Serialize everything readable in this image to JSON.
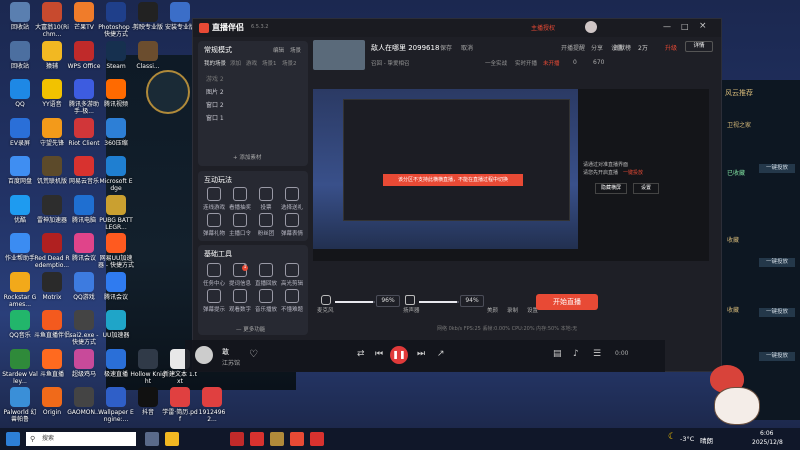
{
  "desktop_icons": [
    {
      "label": "回收站",
      "color": "#5a7fb0"
    },
    {
      "label": "大富翁10(Richm...",
      "color": "#c84a2e"
    },
    {
      "label": "芒果TV",
      "color": "#f07c2a"
    },
    {
      "label": "Photoshop - 快捷方式",
      "color": "#1f3f8a"
    },
    {
      "label": "剪映专业版",
      "color": "#222222"
    },
    {
      "label": "安装专业版",
      "color": "#3b6ec8"
    },
    {
      "label": "回收站",
      "color": "#4c6fa0"
    },
    {
      "label": "猿辅",
      "color": "#f2b822"
    },
    {
      "label": "WPS Office",
      "color": "#c02a2a"
    },
    {
      "label": "Steam",
      "color": "#16304f"
    },
    {
      "label": "Classi...",
      "color": "#6b4d2e"
    },
    {
      "label": "QQ",
      "color": "#1e88e5"
    },
    {
      "label": "YY语音",
      "color": "#f2c200"
    },
    {
      "label": "腾讯多游助手-极...",
      "color": "#3d5ce0"
    },
    {
      "label": "腾讯视频",
      "color": "#ff6a00"
    },
    {
      "label": "EV录屏",
      "color": "#2a6fd8"
    },
    {
      "label": "守望先锋",
      "color": "#f39a1a"
    },
    {
      "label": "Riot Client",
      "color": "#d13639"
    },
    {
      "label": "360压缩",
      "color": "#2d7fd6"
    },
    {
      "label": "百度网盘",
      "color": "#3f8ef2"
    },
    {
      "label": "饥荒联机版",
      "color": "#5c4a2a"
    },
    {
      "label": "网易云音乐",
      "color": "#d8322f"
    },
    {
      "label": "Microsoft Edge",
      "color": "#1f7fd1"
    },
    {
      "label": "优酷",
      "color": "#1e9bf0"
    },
    {
      "label": "雷神加速器",
      "color": "#2d2d2d"
    },
    {
      "label": "腾讯电脑",
      "color": "#1f6fd1"
    },
    {
      "label": "PUBG BATTLEGR...",
      "color": "#caa030"
    },
    {
      "label": "作业帮助手",
      "color": "#3b8cf2"
    },
    {
      "label": "Red Dead Redemptio...",
      "color": "#b02020"
    },
    {
      "label": "腾讯会议",
      "color": "#e0448a"
    },
    {
      "label": "网易UU加速器 - 快捷方式",
      "color": "#ff5a1f"
    },
    {
      "label": "Rockstar Games...",
      "color": "#f2a91a"
    },
    {
      "label": "Motrix",
      "color": "#2a2a2a"
    },
    {
      "label": "QQ游戏",
      "color": "#3d7be0"
    },
    {
      "label": "腾讯会议",
      "color": "#2f7bf0"
    },
    {
      "label": "QQ音乐",
      "color": "#22b66b"
    },
    {
      "label": "斗鱼直播伴侣",
      "color": "#f45a1e"
    },
    {
      "label": "sai2.exe - 快捷方式",
      "color": "#444444"
    },
    {
      "label": "UU加速器",
      "color": "#1fa5c8"
    },
    {
      "label": "Stardew Valley...",
      "color": "#2f8a3a"
    },
    {
      "label": "斗鱼直播",
      "color": "#ff6a1f"
    },
    {
      "label": "超级鸡马",
      "color": "#c84a9a"
    },
    {
      "label": "极速直播",
      "color": "#2a6fd8"
    },
    {
      "label": "Hollow Knight",
      "color": "#303a48"
    },
    {
      "label": "新建文本 1.txt",
      "color": "#e8e8e8"
    },
    {
      "label": "Palworld 幻兽帕鲁",
      "color": "#3a8fd8"
    },
    {
      "label": "Origin",
      "color": "#f06a1a"
    },
    {
      "label": "GAOMON...",
      "color": "#444444"
    },
    {
      "label": "Wallpaper Engine:...",
      "color": "#2f5fc8"
    },
    {
      "label": "抖音",
      "color": "#111111"
    },
    {
      "label": "学雷·简历.pdf",
      "color": "#e04040"
    },
    {
      "label": "19124962...",
      "color": "#e04040"
    }
  ],
  "app": {
    "title": "直播伴侣",
    "version": "6.5.3.2",
    "room_title": "敌人在哪里 2099618",
    "save": "保存",
    "cancel": "取消",
    "category": "召回 - 挚爱相召",
    "tags": [
      "一全实战",
      "实时开播",
      "未开播"
    ],
    "likes": "0",
    "shares": "670",
    "top_links": [
      "主播授权",
      "开播提醒",
      "分享",
      "设置",
      "…",
      "—",
      "□",
      "×"
    ],
    "right_links": [
      "贡献榜",
      "0",
      "2万",
      "升级",
      "详情"
    ],
    "scene_header": "常规模式",
    "scene_actions": [
      "编辑",
      "场景"
    ],
    "scene_tabs": [
      "我的场景",
      "添加",
      "游戏",
      "场景1",
      "场景2"
    ],
    "sources": [
      "游戏 2",
      "图片 2",
      "窗口 2",
      "窗口 1"
    ],
    "add_source": "+ 添加素材",
    "interactive_header": "互动玩法",
    "interactive_tools": [
      "连线游戏",
      "看播抽奖",
      "投票",
      "选择送礼",
      "弹幕礼物",
      "主播口令",
      "粉丝团",
      "弹幕表情"
    ],
    "basic_header": "基础工具",
    "basic_badge": "1",
    "basic_tools": [
      "任务中心",
      "提词信息",
      "直播回放",
      "高光剪辑",
      "弹幕提示",
      "观看数字",
      "音乐播放",
      "不懂难题"
    ],
    "more_functions": "— 更多功能",
    "preview_warning": "该分区不支持此横横直播，不能在直播过程中切换",
    "mic_label": "麦克风",
    "mic_level": 96,
    "mic_text": "96%",
    "speaker_label": "扬声器",
    "speaker_level": 94,
    "speaker_text": "94%",
    "icon_labels": [
      "美颜",
      "录制",
      "设置"
    ],
    "start_button": "开始直播",
    "stats": [
      "网络 0kb/s",
      "FPS:25",
      "丢帧:0.00%",
      "CPU:20%",
      "内存:50%",
      "本地:无"
    ],
    "overlay_panel": {
      "line1": "请通过对准直播界面",
      "line2": "请您先开启直播",
      "link": "一键投放",
      "btn1": "隐藏横屏",
      "btn2": "设置"
    }
  },
  "music": {
    "song": "敢",
    "artist": "江苏馆",
    "time": "0:00"
  },
  "right_panel": {
    "header": "风云推荐",
    "items": [
      "一键投放",
      "一键投放",
      "一键投放",
      "一键投放"
    ],
    "footer": "1114",
    "tags": [
      "卫视之家",
      "已收藏",
      "收藏",
      "收藏"
    ]
  },
  "taskbar": {
    "temperature": "-3°C",
    "weather": "晴朗",
    "time": "6:06",
    "date": "2025/12/8",
    "search_placeholder": "搜索"
  },
  "colors": {
    "accent": "#e84a35",
    "app_bg": "#1e1f26",
    "panel": "#272932"
  }
}
